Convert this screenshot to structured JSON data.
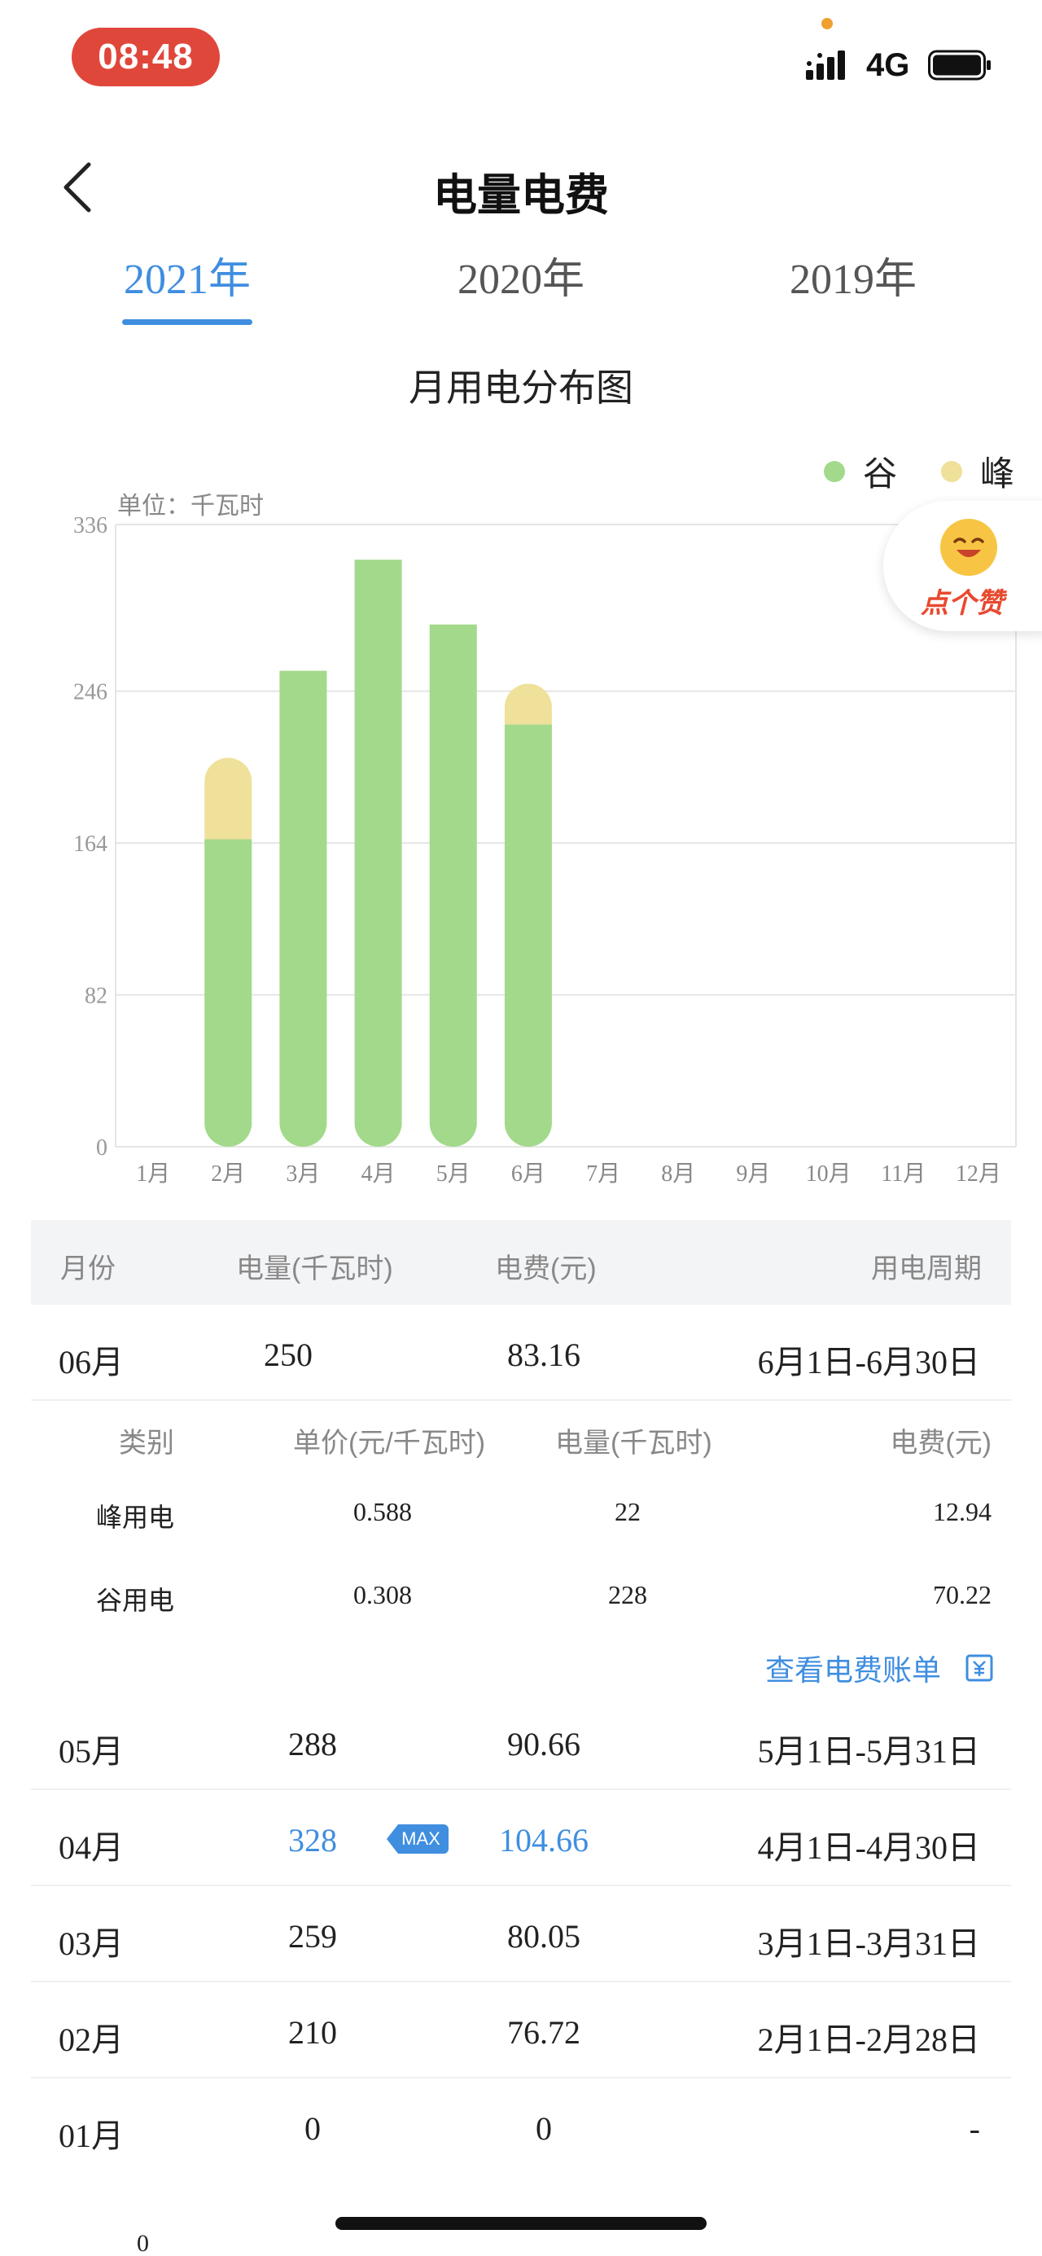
{
  "status": {
    "time": "08:48",
    "network": "4G"
  },
  "header": {
    "title": "电量电费"
  },
  "tabs": [
    {
      "label": "2021年",
      "active": true
    },
    {
      "label": "2020年",
      "active": false
    },
    {
      "label": "2019年",
      "active": false
    }
  ],
  "chart_section": {
    "title": "月用电分布图",
    "unit": "单位：千瓦时",
    "legend": [
      {
        "label": "谷",
        "color": "#a3d98b"
      },
      {
        "label": "峰",
        "color": "#efe09a"
      }
    ]
  },
  "like_badge": {
    "label": "点个赞"
  },
  "chart_data": {
    "type": "bar",
    "stacked": true,
    "categories": [
      "1月",
      "2月",
      "3月",
      "4月",
      "5月",
      "6月",
      "7月",
      "8月",
      "9月",
      "10月",
      "11月",
      "12月"
    ],
    "series": [
      {
        "name": "谷",
        "color": "#a3d98b",
        "values": [
          0,
          166,
          257,
          317,
          282,
          228,
          0,
          0,
          0,
          0,
          0,
          0
        ]
      },
      {
        "name": "峰",
        "color": "#efe09a",
        "values": [
          0,
          44,
          2,
          11,
          6,
          22,
          0,
          0,
          0,
          0,
          0,
          0
        ]
      }
    ],
    "y_ticks": [
      "0",
      "82",
      "164",
      "246",
      "336"
    ],
    "ylim": [
      0,
      336
    ],
    "grid": true
  },
  "table": {
    "headers": {
      "month": "月份",
      "energy": "电量(千瓦时)",
      "fee": "电费(元)",
      "period": "用电周期"
    },
    "expanded": {
      "month": "06月",
      "energy": "250",
      "fee": "83.16",
      "period": "6月1日-6月30日",
      "detail_headers": {
        "type": "类别",
        "price": "单价(元/千瓦时)",
        "energy": "电量(千瓦时)",
        "fee": "电费(元)"
      },
      "details": [
        {
          "type": "峰用电",
          "price": "0.588",
          "energy": "22",
          "fee": "12.94"
        },
        {
          "type": "谷用电",
          "price": "0.308",
          "energy": "228",
          "fee": "70.22"
        }
      ],
      "bill_link": "查看电费账单"
    },
    "rows": [
      {
        "month": "05月",
        "energy": "288",
        "fee": "90.66",
        "period": "5月1日-5月31日"
      },
      {
        "month": "04月",
        "energy": "328",
        "fee": "104.66",
        "period": "4月1日-4月30日",
        "badge": "MAX"
      },
      {
        "month": "03月",
        "energy": "259",
        "fee": "80.05",
        "period": "3月1日-3月31日"
      },
      {
        "month": "02月",
        "energy": "210",
        "fee": "76.72",
        "period": "2月1日-2月28日"
      },
      {
        "month": "01月",
        "energy": "0",
        "fee": "0",
        "period": "-"
      }
    ]
  },
  "bottom_fragment": "0"
}
